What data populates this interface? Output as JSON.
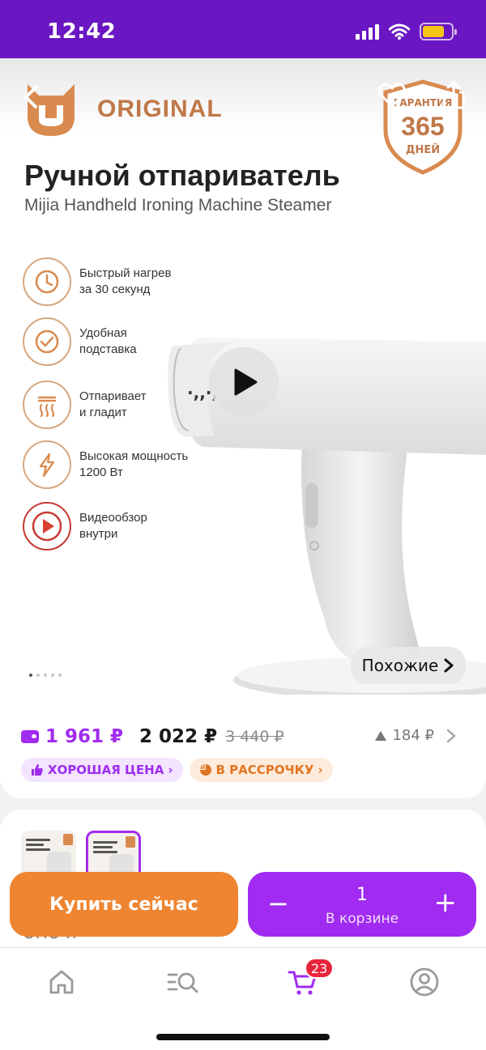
{
  "status_bar": {
    "time": "12:42",
    "battery_level": 0.75
  },
  "hero": {
    "brand": "ORIGINAL",
    "warranty": {
      "top": "ГАРАНТИЯ",
      "number": "365",
      "bottom": "ДНЕЙ"
    },
    "title": "Ручной отпариватель",
    "subtitle": "Mijia Handheld Ironing Machine Steamer",
    "features": [
      {
        "icon": "clock-icon",
        "line1": "Быстрый нагрев",
        "line2": "за 30 секунд"
      },
      {
        "icon": "checkmark-icon",
        "line1": "Удобная",
        "line2": "подставка"
      },
      {
        "icon": "steam-icon",
        "line1": "Отпаривает",
        "line2": "и гладит"
      },
      {
        "icon": "lightning-icon",
        "line1": "Высокая мощность",
        "line2": "1200 Вт"
      },
      {
        "icon": "video-icon",
        "line1": "Видеообзор",
        "line2": "внутри"
      }
    ],
    "similar_label": "Похожие",
    "gallery_dots": 5,
    "active_dot": 0
  },
  "price": {
    "card_price": "1 961 ₽",
    "main_price": "2 022 ₽",
    "old_price": "3 440 ₽",
    "drop": "184 ₽",
    "badge_good": "ХОРОШАЯ ЦЕНА",
    "badge_installment": "В РАССРОЧКУ"
  },
  "gallery": {
    "cut_text": "ОПО Я"
  },
  "actions": {
    "buy_now": "Купить сейчас",
    "minus": "−",
    "plus": "+",
    "quantity": "1",
    "in_cart": "В корзине"
  },
  "tab_bar": {
    "cart_count": "23"
  },
  "colors": {
    "accent": "#a12bf0",
    "status_bar": "#6a16c2",
    "buy": "#ef8530",
    "brand": "#c07848"
  }
}
